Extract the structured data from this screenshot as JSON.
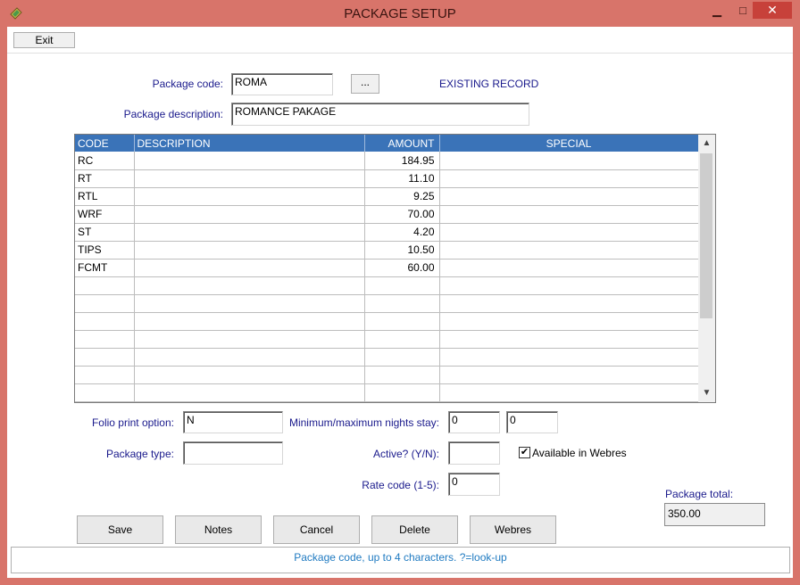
{
  "window": {
    "title": "PACKAGE SETUP",
    "minimize": "▁",
    "maximize": "□",
    "close": "✕"
  },
  "menu": {
    "exit_label": "Exit"
  },
  "form": {
    "package_code_label": "Package code:",
    "package_code_value": "ROMA",
    "lookup_label": "...",
    "record_status": "EXISTING RECORD",
    "package_description_label": "Package description:",
    "package_description_value": "ROMANCE PAKAGE"
  },
  "grid": {
    "columns": {
      "code": "CODE",
      "description": "DESCRIPTION",
      "amount": "AMOUNT",
      "special": "SPECIAL"
    },
    "rows": [
      {
        "code": "RC",
        "description": "",
        "amount": "184.95",
        "special": ""
      },
      {
        "code": "RT",
        "description": "",
        "amount": "11.10",
        "special": ""
      },
      {
        "code": "RTL",
        "description": "",
        "amount": "9.25",
        "special": ""
      },
      {
        "code": "WRF",
        "description": "",
        "amount": "70.00",
        "special": ""
      },
      {
        "code": "ST",
        "description": "",
        "amount": "4.20",
        "special": ""
      },
      {
        "code": "TIPS",
        "description": "",
        "amount": "10.50",
        "special": ""
      },
      {
        "code": "FCMT",
        "description": "",
        "amount": "60.00",
        "special": ""
      },
      {
        "code": "",
        "description": "",
        "amount": "",
        "special": ""
      },
      {
        "code": "",
        "description": "",
        "amount": "",
        "special": ""
      },
      {
        "code": "",
        "description": "",
        "amount": "",
        "special": ""
      },
      {
        "code": "",
        "description": "",
        "amount": "",
        "special": ""
      },
      {
        "code": "",
        "description": "",
        "amount": "",
        "special": ""
      },
      {
        "code": "",
        "description": "",
        "amount": "",
        "special": ""
      },
      {
        "code": "",
        "description": "",
        "amount": "",
        "special": ""
      }
    ]
  },
  "options": {
    "folio_print_label": "Folio print option:",
    "folio_print_value": "N",
    "package_type_label": "Package type:",
    "package_type_value": "",
    "min_max_nights_label": "Minimum/maximum nights stay:",
    "min_nights_value": "0",
    "max_nights_value": "0",
    "active_label": "Active? (Y/N):",
    "active_value": "",
    "webres_label": "Available in Webres",
    "webres_checked": true,
    "rate_code_label": "Rate code (1-5):",
    "rate_code_value": "0"
  },
  "totals": {
    "label": "Package total:",
    "value": "350.00"
  },
  "buttons": {
    "save": "Save",
    "notes": "Notes",
    "cancel": "Cancel",
    "delete": "Delete",
    "webres": "Webres"
  },
  "status_message": "Package code, up to 4 characters. ?=look-up",
  "colors": {
    "frame": "#d8746a",
    "grid_header": "#3a73b8",
    "label_blue": "#1a1a8c",
    "status_text": "#1f7ac1"
  }
}
